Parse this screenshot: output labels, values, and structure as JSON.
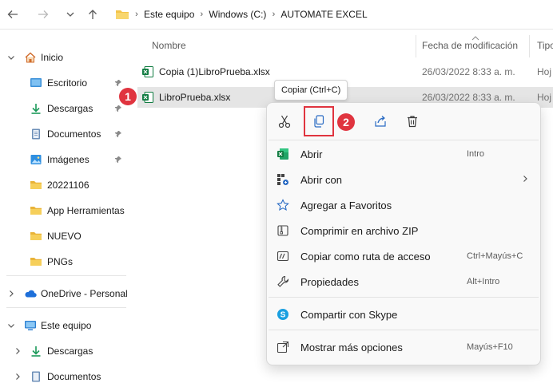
{
  "address": {
    "crumbs": [
      "Este equipo",
      "Windows (C:)",
      "AUTOMATE EXCEL"
    ]
  },
  "sidebar": {
    "home": {
      "label": "Inicio"
    },
    "pinned": [
      {
        "label": "Escritorio",
        "icon": "desktop-icon"
      },
      {
        "label": "Descargas",
        "icon": "download-icon"
      },
      {
        "label": "Documentos",
        "icon": "documents-icon"
      },
      {
        "label": "Imágenes",
        "icon": "pictures-icon"
      }
    ],
    "folders": [
      "20221106",
      "App Herramientas",
      "NUEVO",
      "PNGs"
    ],
    "onedrive": {
      "label": "OneDrive - Personal"
    },
    "this_pc": {
      "label": "Este equipo"
    },
    "this_pc_children": [
      "Descargas",
      "Documentos"
    ]
  },
  "filelist": {
    "columns": {
      "name": "Nombre",
      "date": "Fecha de modificación",
      "type": "Tipo"
    },
    "rows": [
      {
        "name": "Copia (1)LibroPrueba.xlsx",
        "date": "26/03/2022 8:33 a. m.",
        "type": "Hoj"
      },
      {
        "name": "LibroPrueba.xlsx",
        "date": "26/03/2022 8:33 a. m.",
        "type": "Hoj",
        "selected": true
      }
    ]
  },
  "tooltip": {
    "text": "Copiar (Ctrl+C)"
  },
  "badges": {
    "one": "1",
    "two": "2"
  },
  "context_menu": {
    "quick_actions": [
      "cut-icon",
      "copy-icon",
      "share-icon",
      "delete-icon"
    ],
    "items": [
      {
        "label": "Abrir",
        "shortcut": "Intro",
        "icon": "excel-icon"
      },
      {
        "label": "Abrir con",
        "shortcut": "",
        "icon": "open-with-icon",
        "submenu": true
      },
      {
        "label": "Agregar a Favoritos",
        "shortcut": "",
        "icon": "star-icon"
      },
      {
        "label": "Comprimir en archivo ZIP",
        "shortcut": "",
        "icon": "zip-icon"
      },
      {
        "label": "Copiar como ruta de acceso",
        "shortcut": "Ctrl+Mayús+C",
        "icon": "path-icon"
      },
      {
        "label": "Propiedades",
        "shortcut": "Alt+Intro",
        "icon": "wrench-icon"
      },
      {
        "label": "Compartir con Skype",
        "shortcut": "",
        "icon": "skype-icon"
      },
      {
        "label": "Mostrar más opciones",
        "shortcut": "Mayús+F10",
        "icon": "more-options-icon"
      }
    ]
  },
  "colors": {
    "accent": "#e0343f",
    "excel": "#107c41",
    "folder": "#f3c44b",
    "selection": "#e5e5e5"
  }
}
